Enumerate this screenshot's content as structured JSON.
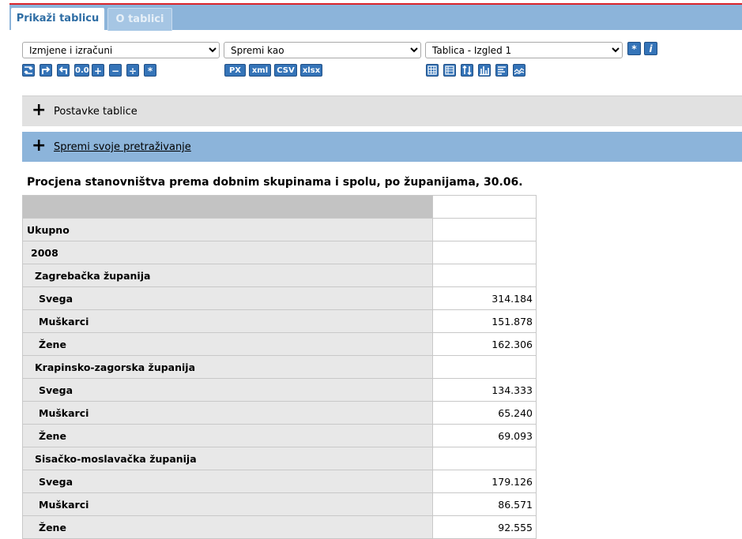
{
  "tabs": {
    "active": "Prikaži tablicu",
    "inactive": "O tablici"
  },
  "toolbar": {
    "changes_select": "Izmjene i izračuni",
    "save_select": "Spremi kao",
    "layout_select": "Tablica - Izgled 1",
    "calc_buttons": [
      "0.0",
      "+",
      "−",
      "÷",
      "*"
    ],
    "export_buttons": [
      "PX",
      "xml",
      "CSV",
      "xlsx"
    ],
    "star_button": "*",
    "info_button": "i"
  },
  "panels": {
    "settings": "Postavke tablice",
    "save_search": "Spremi svoje pretraživanje",
    "expand_symbol": "+"
  },
  "table": {
    "title": "Procjena stanovništva prema dobnim skupinama i spolu, po županijama, 30.06.",
    "rows": [
      {
        "label": "Ukupno",
        "value": ""
      },
      {
        "label": "2008",
        "value": ""
      },
      {
        "label": "Zagrebačka županija",
        "value": ""
      },
      {
        "label": "Svega",
        "value": "314.184"
      },
      {
        "label": "Muškarci",
        "value": "151.878"
      },
      {
        "label": "Žene",
        "value": "162.306"
      },
      {
        "label": "Krapinsko-zagorska županija",
        "value": ""
      },
      {
        "label": "Svega",
        "value": "134.333"
      },
      {
        "label": "Muškarci",
        "value": "65.240"
      },
      {
        "label": "Žene",
        "value": "69.093"
      },
      {
        "label": "Sisačko-moslavačka županija",
        "value": ""
      },
      {
        "label": "Svega",
        "value": "179.126"
      },
      {
        "label": "Muškarci",
        "value": "86.571"
      },
      {
        "label": "Žene",
        "value": "92.555"
      }
    ]
  },
  "colors": {
    "accent_blue": "#8cb4da",
    "button_blue": "#3574b8",
    "top_line": "#d9242b"
  }
}
